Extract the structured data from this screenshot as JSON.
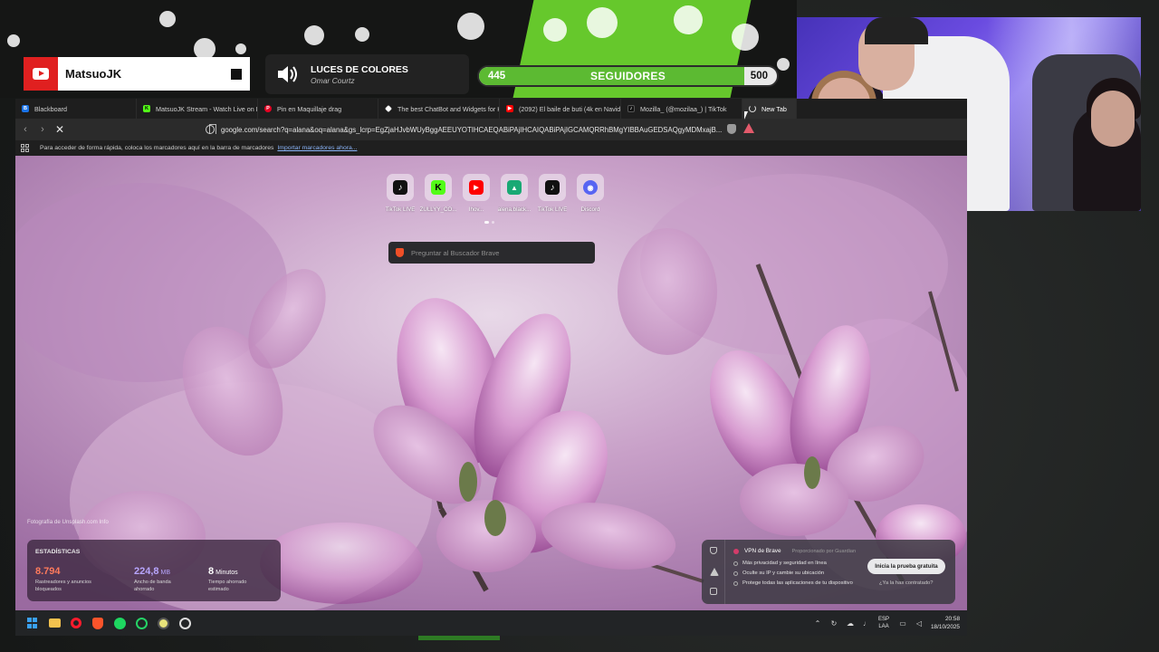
{
  "overlay": {
    "channel_name": "MatsuoJK",
    "song_title": "LUCES DE COLORES",
    "song_artist": "Omar Courtz",
    "followers": {
      "current": "445",
      "label": "SEGUIDORES",
      "goal": "500",
      "progress": 0.89
    }
  },
  "browser": {
    "tabs": [
      {
        "title": "Blackboard",
        "favicon": "blackboard-icon",
        "color": "#1a73e8"
      },
      {
        "title": "MatsuoJK Stream - Watch Live on Ki",
        "favicon": "kick-icon",
        "color": "#53fc18"
      },
      {
        "title": "Pin en Maquillaje drag",
        "favicon": "pinterest-icon",
        "color": "#e60023"
      },
      {
        "title": "The best ChatBot and Widgets for Ki",
        "favicon": "diamond-icon",
        "color": "#ffffff"
      },
      {
        "title": "(2092) El baile de buti (4k en Navida",
        "favicon": "youtube-icon",
        "color": "#ff0000"
      },
      {
        "title": "Mozilla_ (@mozilaa_) | TikTok",
        "favicon": "tiktok-icon",
        "color": "#111111"
      },
      {
        "title": "New Tab",
        "favicon": "loading-icon",
        "color": "#888888"
      }
    ],
    "url": "google.com/search?q=alana&oq=alana&gs_lcrp=EgZjaHJvbWUyBggAEEUYOTIHCAEQABiPAjIHCAIQABiPAjIGCAMQRRhBMgYIBBAuGEDSAQgyMDMxajB...",
    "bookmarks_hint": "Para acceder de forma rápida, coloca los marcadores aquí en la barra de marcadores",
    "bookmarks_import": "Importar marcadores ahora...",
    "shortcuts": [
      {
        "label": "TikTok LIVE",
        "icon": "tiktok-icon",
        "color": "#111111",
        "glyph": "♪"
      },
      {
        "label": "ZULLYY_CO...",
        "icon": "kick-icon",
        "color": "#53fc18",
        "glyph": "K"
      },
      {
        "label": "Ihov...",
        "icon": "youtube-icon",
        "color": "#ff0000",
        "glyph": "▶"
      },
      {
        "label": "alena.black...",
        "icon": "arrow-up-icon",
        "color": "#19a974",
        "glyph": "▲"
      },
      {
        "label": "TikTok LIVE",
        "icon": "tiktok-icon",
        "color": "#111111",
        "glyph": "♪"
      },
      {
        "label": "Discord",
        "icon": "discord-icon",
        "color": "#5865f2",
        "glyph": "◉"
      }
    ],
    "search_placeholder": "Preguntar al Buscador Brave",
    "photo_credit": "Fotografía de Unsplash.com Info",
    "stats": {
      "title": "ESTADÍSTICAS",
      "items": [
        {
          "value": "8.794",
          "unit": "",
          "desc": "Rastreadores y anuncios bloqueados",
          "color": "#ff7a5c"
        },
        {
          "value": "224,8",
          "unit": "MB",
          "desc": "Ancho de banda ahorrado",
          "color": "#b8a6ff"
        },
        {
          "value": "8",
          "unit": "Minutos",
          "desc": "Tiempo ahorrado estimado",
          "color": "#ffffff"
        }
      ]
    },
    "vpn": {
      "title": "VPN de Brave",
      "powered": "Proporcionado por Guardian",
      "features": [
        "Más privacidad y seguridad en línea",
        "Oculte su IP y cambie su ubicación",
        "Protege todas las aplicaciones de tu dispositivo"
      ],
      "cta": "Inicia la prueba gratuita",
      "link": "¿Ya la has contratado?"
    }
  },
  "taskbar": {
    "apps": [
      {
        "name": "start-button",
        "color": "#3aa0f0"
      },
      {
        "name": "file-explorer-icon",
        "color": "#f2c14e"
      },
      {
        "name": "opera-icon",
        "color": "#ff1b2d"
      },
      {
        "name": "brave-icon",
        "color": "#fb542b"
      },
      {
        "name": "spotify-icon",
        "color": "#1ed760"
      },
      {
        "name": "whatsapp-icon",
        "color": "#25d366"
      },
      {
        "name": "app-icon",
        "color": "#e8e27a"
      },
      {
        "name": "tool-icon",
        "color": "#dddddd"
      }
    ],
    "lang_top": "ESP",
    "lang_bottom": "LAA",
    "time": "20:58",
    "date": "18/10/2025"
  }
}
